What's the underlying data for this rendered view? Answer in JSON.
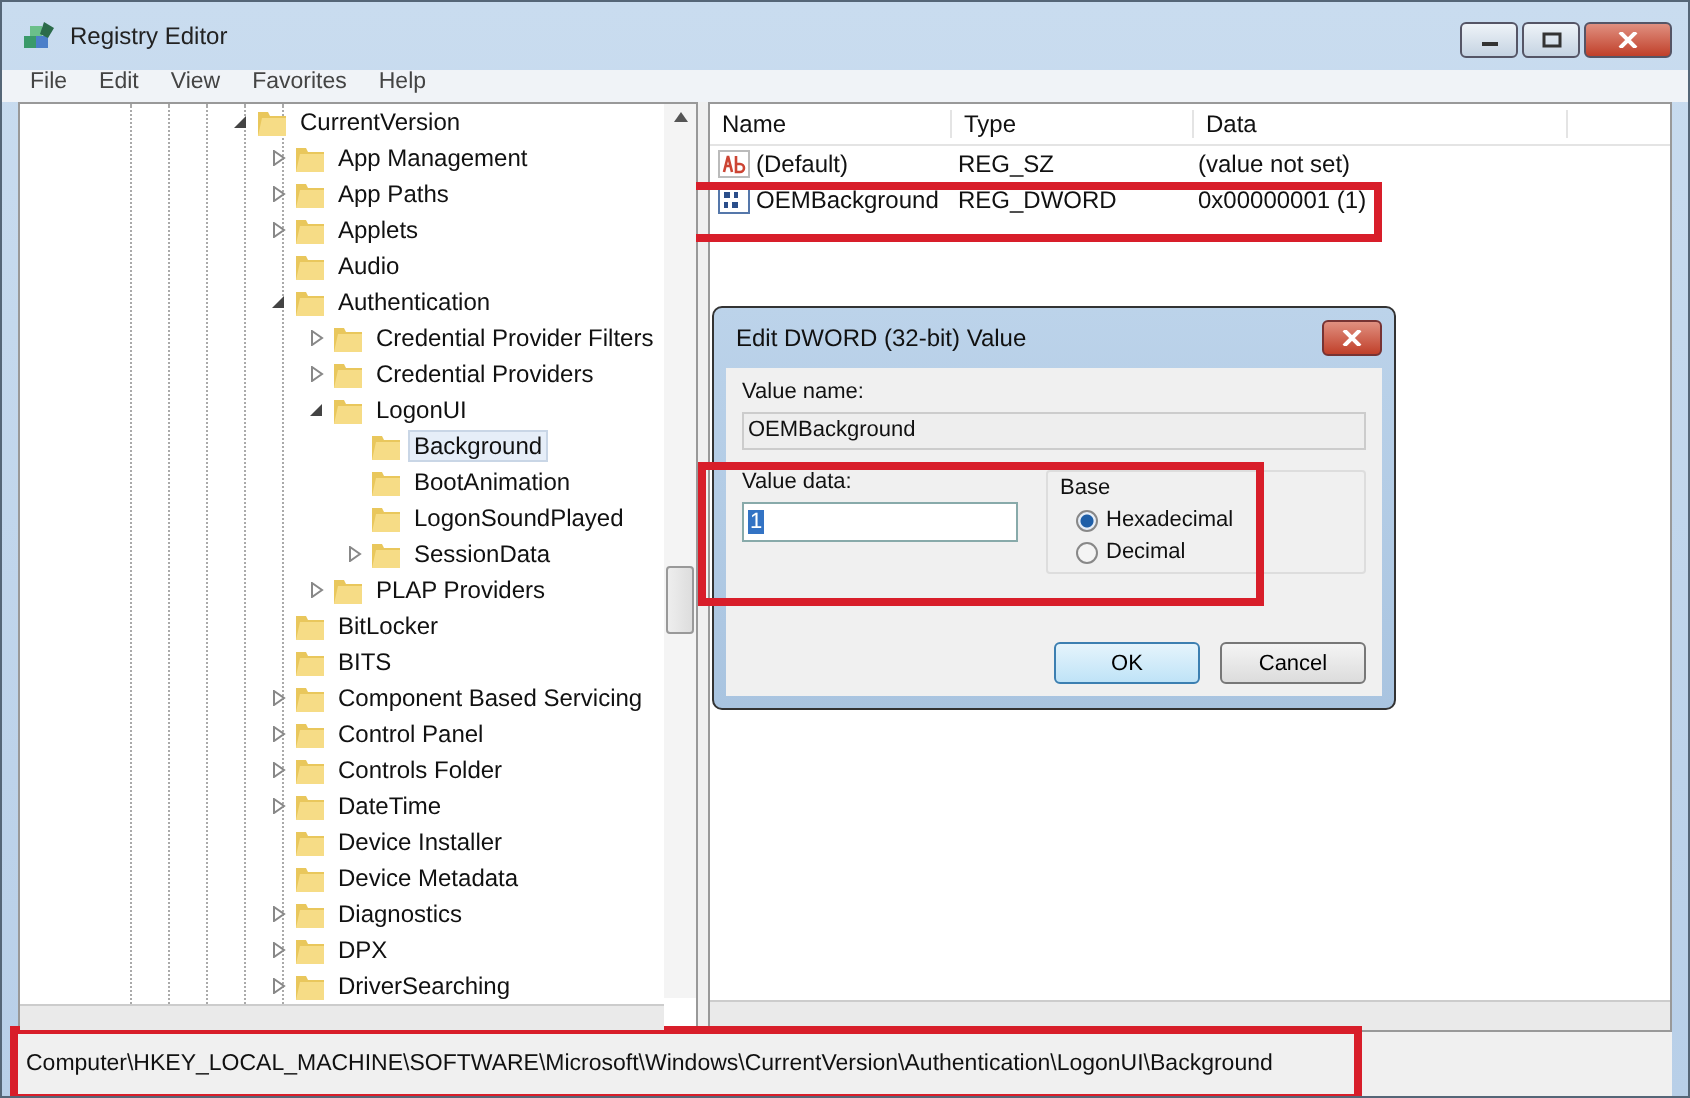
{
  "window": {
    "title": "Registry Editor"
  },
  "menu": [
    "File",
    "Edit",
    "View",
    "Favorites",
    "Help"
  ],
  "tree": [
    {
      "label": "CurrentVersion",
      "expandable": true,
      "expanded": true,
      "selected": false,
      "children": [
        {
          "label": "App Management",
          "expandable": true,
          "expanded": false,
          "selected": false
        },
        {
          "label": "App Paths",
          "expandable": true,
          "expanded": false,
          "selected": false
        },
        {
          "label": "Applets",
          "expandable": true,
          "expanded": false,
          "selected": false
        },
        {
          "label": "Audio",
          "expandable": false,
          "selected": false
        },
        {
          "label": "Authentication",
          "expandable": true,
          "expanded": true,
          "selected": false,
          "children": [
            {
              "label": "Credential Provider Filters",
              "expandable": true,
              "expanded": false,
              "selected": false
            },
            {
              "label": "Credential Providers",
              "expandable": true,
              "expanded": false,
              "selected": false
            },
            {
              "label": "LogonUI",
              "expandable": true,
              "expanded": true,
              "selected": false,
              "children": [
                {
                  "label": "Background",
                  "expandable": false,
                  "selected": true
                },
                {
                  "label": "BootAnimation",
                  "expandable": false,
                  "selected": false
                },
                {
                  "label": "LogonSoundPlayed",
                  "expandable": false,
                  "selected": false
                },
                {
                  "label": "SessionData",
                  "expandable": true,
                  "expanded": false,
                  "selected": false
                }
              ]
            },
            {
              "label": "PLAP Providers",
              "expandable": true,
              "expanded": false,
              "selected": false
            }
          ]
        },
        {
          "label": "BitLocker",
          "expandable": false,
          "selected": false
        },
        {
          "label": "BITS",
          "expandable": false,
          "selected": false
        },
        {
          "label": "Component Based Servicing",
          "expandable": true,
          "expanded": false,
          "selected": false
        },
        {
          "label": "Control Panel",
          "expandable": true,
          "expanded": false,
          "selected": false
        },
        {
          "label": "Controls Folder",
          "expandable": true,
          "expanded": false,
          "selected": false
        },
        {
          "label": "DateTime",
          "expandable": true,
          "expanded": false,
          "selected": false
        },
        {
          "label": "Device Installer",
          "expandable": false,
          "selected": false
        },
        {
          "label": "Device Metadata",
          "expandable": false,
          "selected": false
        },
        {
          "label": "Diagnostics",
          "expandable": true,
          "expanded": false,
          "selected": false
        },
        {
          "label": "DPX",
          "expandable": true,
          "expanded": false,
          "selected": false
        },
        {
          "label": "DriverSearching",
          "expandable": true,
          "expanded": false,
          "selected": false
        }
      ]
    }
  ],
  "values": {
    "columns": [
      "Name",
      "Type",
      "Data"
    ],
    "rows": [
      {
        "kind": "string",
        "name": "(Default)",
        "type": "REG_SZ",
        "data": "(value not set)"
      },
      {
        "kind": "binary",
        "name": "OEMBackground",
        "type": "REG_DWORD",
        "data": "0x00000001 (1)"
      }
    ]
  },
  "dialog": {
    "title": "Edit DWORD (32-bit) Value",
    "value_name_label": "Value name:",
    "value_name": "OEMBackground",
    "value_data_label": "Value data:",
    "value_data": "1",
    "base_label": "Base",
    "bases": [
      {
        "label": "Hexadecimal",
        "selected": true
      },
      {
        "label": "Decimal",
        "selected": false
      }
    ],
    "buttons": [
      "OK",
      "Cancel"
    ]
  },
  "status_bar": "Computer\\HKEY_LOCAL_MACHINE\\SOFTWARE\\Microsoft\\Windows\\CurrentVersion\\Authentication\\LogonUI\\Background"
}
